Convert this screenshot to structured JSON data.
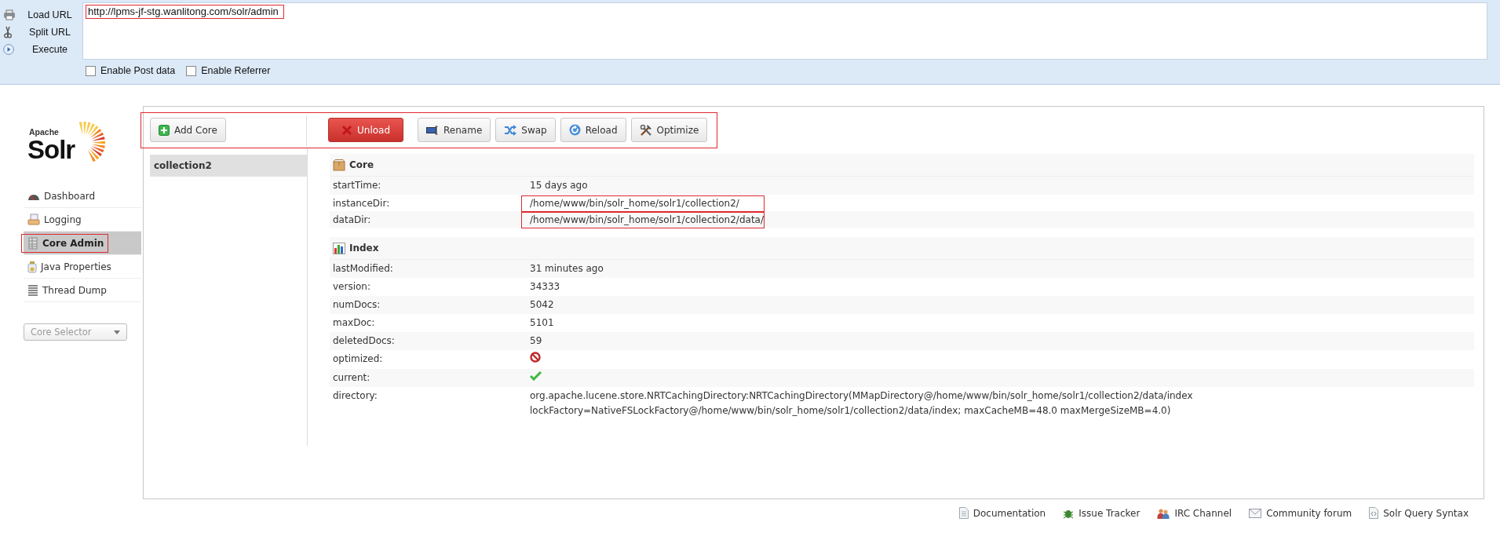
{
  "hackbar": {
    "actions": [
      {
        "label": "Load URL"
      },
      {
        "label": "Split URL"
      },
      {
        "label": "Execute"
      }
    ],
    "url": {
      "value": "http://lpms-jf-stg.wanlitong.com/solr/admin",
      "highlighted": true
    },
    "options": [
      {
        "label": "Enable Post data",
        "checked": false
      },
      {
        "label": "Enable Referrer",
        "checked": false
      }
    ]
  },
  "logo": {
    "small": "Apache",
    "big": "Solr"
  },
  "sidebar": {
    "items": [
      {
        "label": "Dashboard",
        "selected": false,
        "highlighted": false
      },
      {
        "label": "Logging",
        "selected": false,
        "highlighted": false
      },
      {
        "label": "Core Admin",
        "selected": true,
        "highlighted": true
      },
      {
        "label": "Java Properties",
        "selected": false,
        "highlighted": false
      },
      {
        "label": "Thread Dump",
        "selected": false,
        "highlighted": false
      }
    ],
    "core_selector": {
      "placeholder": "Core Selector"
    }
  },
  "core_admin": {
    "toolbar_highlighted": true,
    "add_button": "Add Core",
    "cores": [
      {
        "name": "collection2",
        "selected": true
      }
    ],
    "actions": [
      {
        "label": "Unload",
        "kind": "danger"
      },
      {
        "label": "Rename",
        "kind": "normal"
      },
      {
        "label": "Swap",
        "kind": "normal"
      },
      {
        "label": "Reload",
        "kind": "normal"
      },
      {
        "label": "Optimize",
        "kind": "normal"
      }
    ],
    "sections": [
      {
        "title": "Core",
        "rows": [
          {
            "key": "startTime:",
            "kind": "text",
            "value": "15 days ago",
            "highlighted": false
          },
          {
            "key": "instanceDir:",
            "kind": "text",
            "value": "/home/www/bin/solr_home/solr1/collection2/",
            "highlighted": true
          },
          {
            "key": "dataDir:",
            "kind": "text",
            "value": "/home/www/bin/solr_home/solr1/collection2/data/",
            "highlighted": true
          }
        ]
      },
      {
        "title": "Index",
        "rows": [
          {
            "key": "lastModified:",
            "kind": "text",
            "value": "31 minutes ago",
            "highlighted": false
          },
          {
            "key": "version:",
            "kind": "text",
            "value": "34333",
            "highlighted": false
          },
          {
            "key": "numDocs:",
            "kind": "text",
            "value": "5042",
            "highlighted": false
          },
          {
            "key": "maxDoc:",
            "kind": "text",
            "value": "5101",
            "highlighted": false
          },
          {
            "key": "deletedDocs:",
            "kind": "text",
            "value": "59",
            "highlighted": false
          },
          {
            "key": "optimized:",
            "kind": "flag",
            "on": false,
            "highlighted": false
          },
          {
            "key": "current:",
            "kind": "flag",
            "on": true,
            "highlighted": false
          },
          {
            "key": "directory:",
            "kind": "text",
            "value": "org.apache.lucene.store.NRTCachingDirectory:NRTCachingDirectory(MMapDirectory@/home/www/bin/solr_home/solr1/collection2/data/index lockFactory=NativeFSLockFactory@/home/www/bin/solr_home/solr1/collection2/data/index; maxCacheMB=48.0 maxMergeSizeMB=4.0)",
            "highlighted": false
          }
        ]
      }
    ]
  },
  "footer": {
    "links": [
      {
        "label": "Documentation"
      },
      {
        "label": "Issue Tracker"
      },
      {
        "label": "IRC Channel"
      },
      {
        "label": "Community forum"
      },
      {
        "label": "Solr Query Syntax"
      }
    ]
  }
}
